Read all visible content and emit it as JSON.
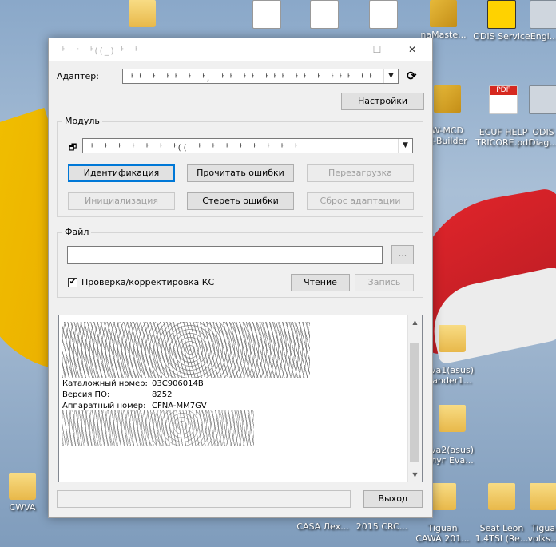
{
  "desktop": {
    "icons": [
      {
        "id": "folder-top",
        "label": "",
        "kind": "folder"
      },
      {
        "id": "odis-service",
        "label": "ODIS Service",
        "kind": "odis"
      },
      {
        "id": "engineering",
        "label": "Engi...",
        "kind": "grey"
      },
      {
        "id": "w-mcd",
        "label": "W-MCD\nX-Builder",
        "kind": "box"
      },
      {
        "id": "ecuf-help",
        "label": "ECUF HELP\nTRICORE.pdf",
        "kind": "pdf"
      },
      {
        "id": "odis-diag",
        "label": "ODIS\nDiag...",
        "kind": "grey"
      },
      {
        "id": "eva1",
        "label": "va1(asus)\nander1...",
        "kind": "folder"
      },
      {
        "id": "eva2",
        "label": "va2(asus)\nлуг Eva...",
        "kind": "folder"
      },
      {
        "id": "cwva",
        "label": "CWVA",
        "kind": "folder"
      },
      {
        "id": "tiguan-cawa",
        "label": "Tiguan\nCAWA 201...",
        "kind": "folder"
      },
      {
        "id": "seat-leon",
        "label": "Seat Leon\n1.4TSI (Re...",
        "kind": "folder"
      },
      {
        "id": "tiguan-volks",
        "label": "Tigua\nvolks...",
        "kind": "folder"
      },
      {
        "id": "casa",
        "label": "CASA Лех...",
        "kind": "folder"
      },
      {
        "id": "crc-2015",
        "label": "2015 CRC...",
        "kind": "folder"
      },
      {
        "id": "tiguan-top",
        "label": "naMaste...",
        "kind": "box"
      }
    ]
  },
  "window": {
    "title_obscured": "ᅡ ᅡ ᅡ((_)ᅡ ᅡ",
    "controls": {
      "minimize": "—",
      "maximize": "☐",
      "close": "✕"
    },
    "adapter_label": "Адаптер:",
    "adapter_value": "ᅡᅡ ᅡ ᅡᅡ ᅡ ᅡ, ᅡᅡ ᅡᅡ ᅡᅡᅡ ᅡᅡ ᅡ ᅡᅡᅡ ᅡᅡ ᅡ ᅡᅡ",
    "refresh_icon": "⟳",
    "settings_label": "Настройки",
    "module_group": "Модуль",
    "module_value": "ᅡ ᅡ ᅡ ᅡ ᅡ ᅡ ᅡ(( ᅡ ᅡ ᅡ ᅡ ᅡ ᅡ ᅡ ᅡ",
    "buttons": {
      "identify": "Идентификация",
      "read_errors": "Прочитать ошибки",
      "reboot": "Перезагрузка",
      "init": "Инициализация",
      "clear_errors": "Стереть ошибки",
      "reset_adapt": "Сброс адаптации"
    },
    "file_group": "Файл",
    "file_value": "",
    "browse_label": "...",
    "checkbox_label": "Проверка/корректировка КС",
    "checkbox_checked": "✔",
    "read_label": "Чтение",
    "write_label": "Запись",
    "log": {
      "catalog_key": "Каталожный номер:",
      "catalog_val": "03C906014B",
      "sw_key": "Версия ПО:",
      "sw_val": "8252",
      "hw_key": "Аппаратный номер:",
      "hw_val": "CFNA-MM7GV"
    },
    "status_text": "",
    "exit_label": "Выход"
  }
}
